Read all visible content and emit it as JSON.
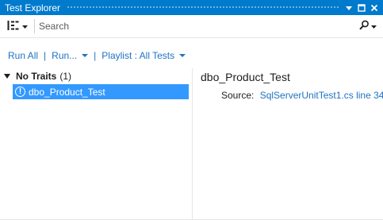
{
  "window": {
    "title": "Test Explorer",
    "buttons": [
      "dropdown-icon",
      "maximize-icon",
      "close-icon"
    ]
  },
  "search": {
    "placeholder": "Search",
    "group_by_icon": "group-by-icon"
  },
  "commands": {
    "run_all": "Run All",
    "run": "Run...",
    "playlist": "Playlist : All Tests"
  },
  "tree": {
    "group_name": "No Traits",
    "group_count": "(1)",
    "tests": [
      {
        "name": "dbo_Product_Test",
        "status": "warning-icon",
        "selected": true
      }
    ]
  },
  "detail": {
    "title": "dbo_Product_Test",
    "source_label": "Source:",
    "source_link": "SqlServerUnitTest1.cs line 34"
  },
  "colors": {
    "titlebar": "#007acc",
    "selection": "#3399ff",
    "link": "#1e73c2"
  }
}
